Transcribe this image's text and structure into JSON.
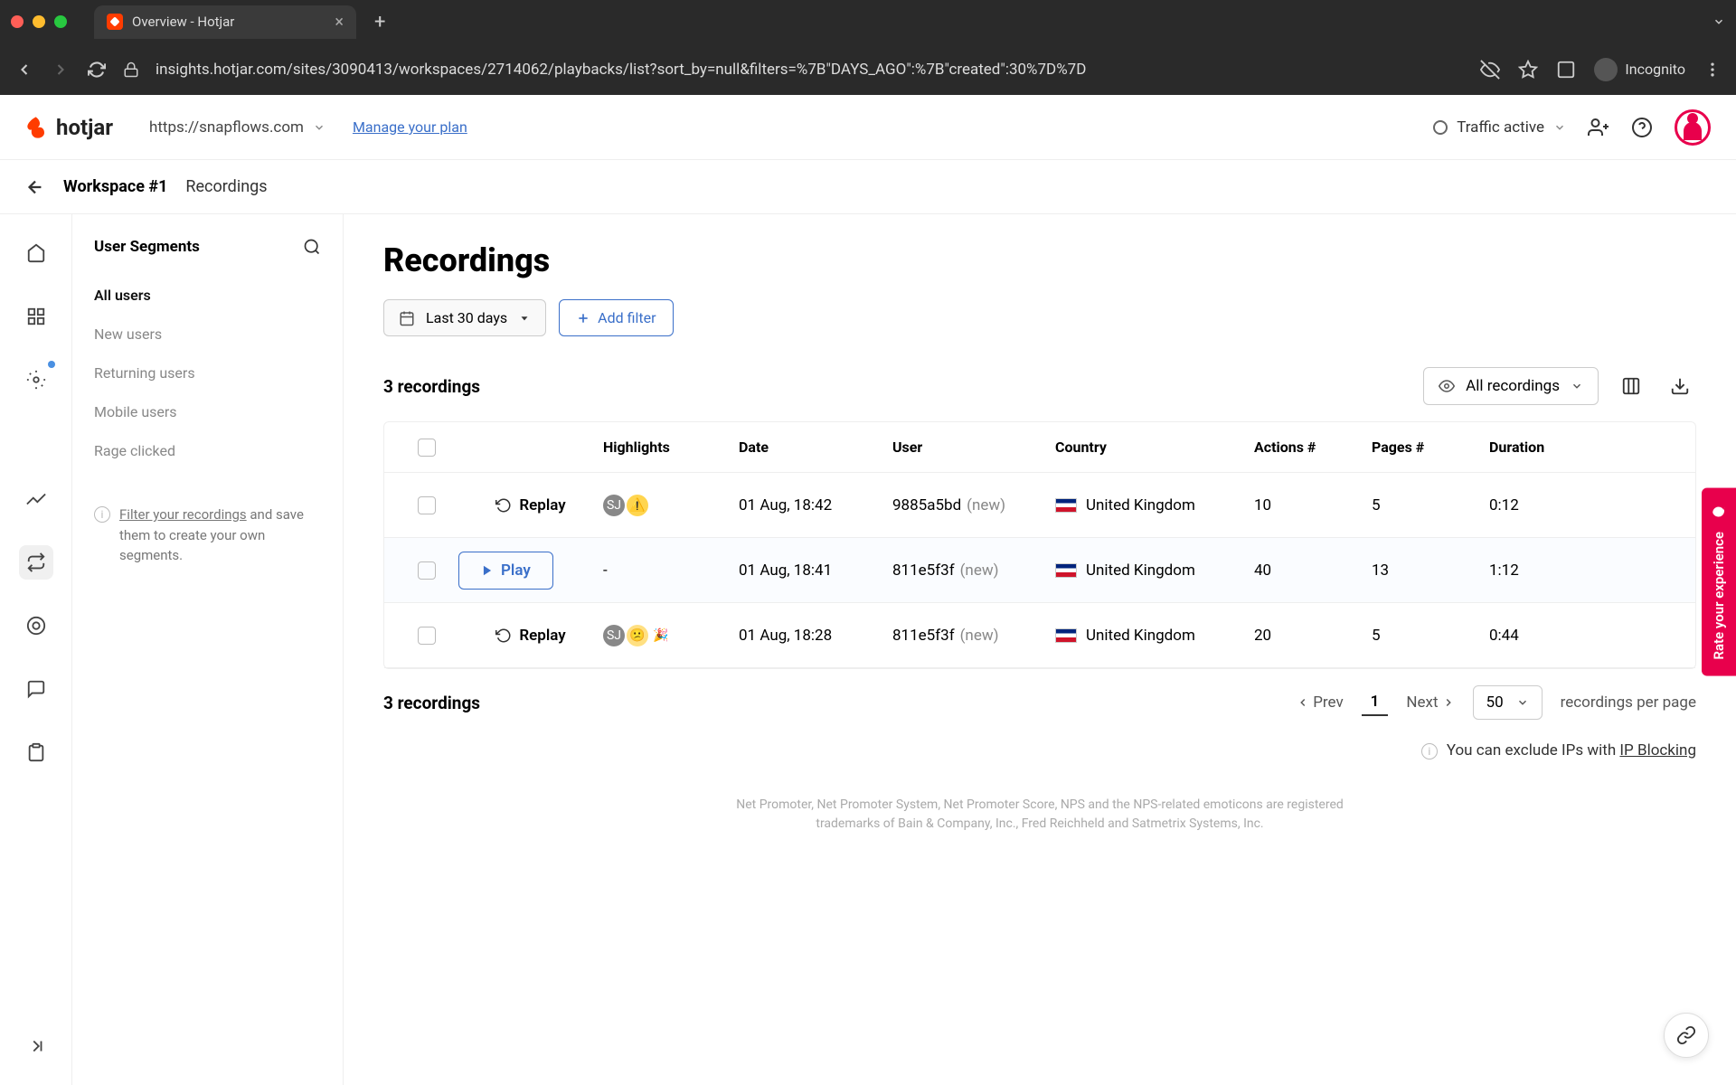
{
  "browser": {
    "tab_title": "Overview - Hotjar",
    "url": "insights.hotjar.com/sites/3090413/workspaces/2714062/playbacks/list?sort_by=null&filters=%7B\"DAYS_AGO\":%7B\"created\":30%7D%7D",
    "incognito_label": "Incognito"
  },
  "header": {
    "logo_text": "hotjar",
    "site_url": "https://snapflows.com",
    "manage_plan": "Manage your plan",
    "traffic_status": "Traffic active"
  },
  "breadcrumb": {
    "workspace": "Workspace #1",
    "page": "Recordings"
  },
  "segments": {
    "title": "User Segments",
    "items": [
      "All users",
      "New users",
      "Returning users",
      "Mobile users",
      "Rage clicked"
    ],
    "hint_link": "Filter your recordings",
    "hint_rest": " and save them to create your own segments."
  },
  "main": {
    "title": "Recordings",
    "date_filter": "Last 30 days",
    "add_filter": "Add filter",
    "count_label_top": "3 recordings",
    "view_selector": "All recordings",
    "columns": [
      "Highlights",
      "Date",
      "User",
      "Country",
      "Actions #",
      "Pages #",
      "Duration"
    ],
    "rows": [
      {
        "action": "Replay",
        "highlights": [
          "SJ",
          "⚠️"
        ],
        "date": "01 Aug, 18:42",
        "user_id": "9885a5bd",
        "user_tag": "(new)",
        "country": "United Kingdom",
        "actions": "10",
        "pages": "5",
        "duration": "0:12"
      },
      {
        "action": "Play",
        "highlights_text": "-",
        "date": "01 Aug, 18:41",
        "user_id": "811e5f3f",
        "user_tag": "(new)",
        "country": "United Kingdom",
        "actions": "40",
        "pages": "13",
        "duration": "1:12"
      },
      {
        "action": "Replay",
        "highlights": [
          "SJ",
          "😕",
          "🎉"
        ],
        "date": "01 Aug, 18:28",
        "user_id": "811e5f3f",
        "user_tag": "(new)",
        "country": "United Kingdom",
        "actions": "20",
        "pages": "5",
        "duration": "0:44"
      }
    ],
    "count_label_bottom": "3 recordings",
    "pagination": {
      "prev": "Prev",
      "page": "1",
      "next": "Next",
      "per_page": "50",
      "per_page_label": "recordings per page"
    },
    "ip_note_prefix": "You can exclude IPs with ",
    "ip_note_link": "IP Blocking",
    "legal": "Net Promoter, Net Promoter System, Net Promoter Score, NPS and the NPS-related emoticons are registered trademarks of Bain & Company, Inc., Fred Reichheld and Satmetrix Systems, Inc."
  },
  "feedback_tab": "Rate your experience"
}
